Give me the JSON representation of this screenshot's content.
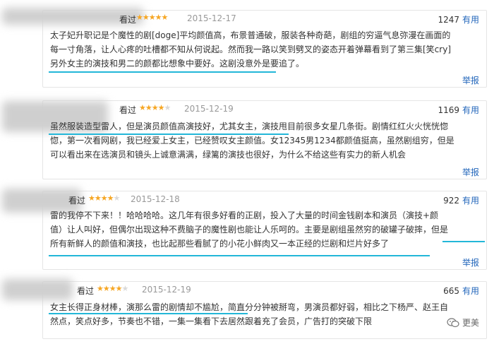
{
  "reviews": [
    {
      "status": "看过",
      "rating": 5,
      "date": "2015-12-17",
      "useful_count": "1247",
      "useful_label": "有用",
      "lines": [
        "太子妃升职记是个魔性的剧[doge]平均颜值高，布景普通破，服装各种奇葩，剧组的穷逼气息弥漫在画面的",
        "每一寸角落，让人心疼的吐槽都不知从何说起。然而我一路以笑到劈叉的姿态开着弹幕看到了第三集[笑cry]",
        "另外女主的演技和男二的颜都比想象中要好。这剧没意外是要追了。"
      ],
      "report": "举报"
    },
    {
      "status": "看过",
      "rating": 4,
      "date": "2015-12-19",
      "useful_count": "1169",
      "useful_label": "有用",
      "lines": [
        "虽然服装造型雷人，但是演员颜值高演技好，尤其女主，演技甩目前很多女星几条街。剧情红红火火恍恍惚",
        "惚，第一次看网剧，我已经爱上女主，已经赞叹女主颜值。女12345男1234都颜值挺高，虽然剧组穷，但是",
        "可以看出来在选演员和镜头上诚意满满，绿篱的演技也很好，为什么不给这些有实力的新人机会"
      ],
      "report": "举报"
    },
    {
      "status": "看过",
      "rating": 4,
      "date": "2015-12-18",
      "useful_count": "922",
      "useful_label": "有用",
      "lines": [
        "雷的我停不下来！！哈哈哈哈。这几年有很多好看的正剧，投入了大量的时间金钱剧本和演员（演技+颜",
        "值）让人叫好，但偶尔出现这种不费脑子的魔性剧也能让人乐呵的。主要是剧组虽然穷的破罐子破摔，但是",
        "所有新鲜人的颜值和演技，也比起那些看腻了的小花小鲜肉又一本正经的烂剧和烂片好多了"
      ],
      "report": "举报"
    },
    {
      "status": "看过",
      "rating": 4,
      "date": "2015-12-19",
      "useful_count": "665",
      "useful_label": "有用",
      "lines": [
        "女主长得正身材棒，演那么雷的剧情却不尴尬，简直分分钟被掰弯，男演员都好弱，相比之下杨严、赵王自",
        "然点，笑点好多，节奏也不错，一集一集看下去居然跟着充了会员，广告打的突破下限"
      ],
      "report": ""
    }
  ],
  "watermark": {
    "text": "更美",
    "icon": "wechat-icon"
  },
  "colors": {
    "link": "#2266bb",
    "star": "#f6a623",
    "highlight": "#23b7d8"
  }
}
